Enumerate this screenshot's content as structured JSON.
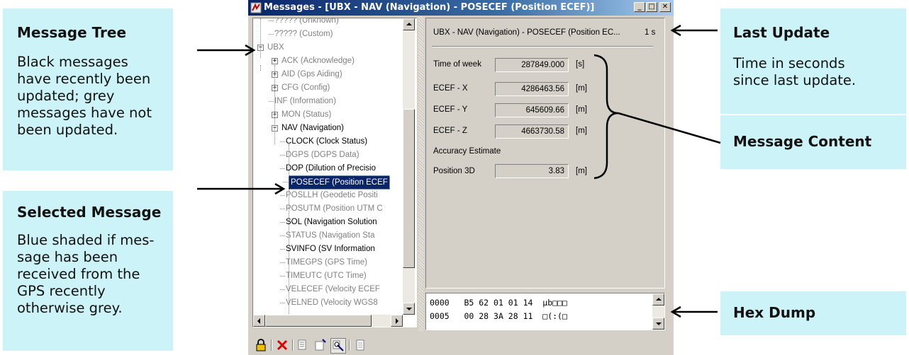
{
  "window": {
    "title": "Messages - [UBX - NAV (Navigation) - POSECEF (Position ECEF)]",
    "buttons": {
      "minimize": "_",
      "maximize": "□",
      "close": "✕"
    }
  },
  "tree": {
    "nodes": [
      {
        "label": "????? (Unknown)",
        "state": "grey"
      },
      {
        "label": "????? (Custom)",
        "state": "grey"
      },
      {
        "label": "UBX",
        "state": "grey",
        "expander": "−"
      },
      {
        "label": "ACK (Acknowledge)",
        "state": "grey",
        "expander": "+"
      },
      {
        "label": "AID (Gps Aiding)",
        "state": "grey",
        "expander": "+"
      },
      {
        "label": "CFG (Config)",
        "state": "grey",
        "expander": "+"
      },
      {
        "label": "INF (Information)",
        "state": "grey"
      },
      {
        "label": "MON (Status)",
        "state": "grey",
        "expander": "+"
      },
      {
        "label": "NAV (Navigation)",
        "state": "black",
        "expander": "−"
      },
      {
        "label": "CLOCK (Clock Status)",
        "state": "black"
      },
      {
        "label": "DGPS (DGPS Data)",
        "state": "grey"
      },
      {
        "label": "DOP (Dilution of Precisio",
        "state": "black"
      },
      {
        "label": "POSECEF (Position ECEF",
        "state": "selected"
      },
      {
        "label": "POSLLH (Geodetic Positi",
        "state": "grey"
      },
      {
        "label": "POSUTM (Position UTM C",
        "state": "grey"
      },
      {
        "label": "SOL (Navigation Solution",
        "state": "black"
      },
      {
        "label": "STATUS (Navigation Sta",
        "state": "grey"
      },
      {
        "label": "SVINFO (SV Information",
        "state": "black"
      },
      {
        "label": "TIMEGPS (GPS Time)",
        "state": "grey"
      },
      {
        "label": "TIMEUTC (UTC Time)",
        "state": "grey"
      },
      {
        "label": "VELECEF (Velocity ECEF",
        "state": "grey"
      },
      {
        "label": "VELNED (Velocity WGS8",
        "state": "grey"
      }
    ]
  },
  "content": {
    "header": "UBX - NAV (Navigation) - POSECEF (Position EC...",
    "age": "1 s",
    "fields": [
      {
        "label": "Time of week",
        "value": "287849.000",
        "unit": "[s]"
      },
      {
        "label": "ECEF - X",
        "value": "4286463.56",
        "unit": "[m]"
      },
      {
        "label": "ECEF - Y",
        "value": "645609.66",
        "unit": "[m]"
      },
      {
        "label": "ECEF - Z",
        "value": "4663730.58",
        "unit": "[m]"
      }
    ],
    "section": "Accuracy Estimate",
    "accuracy": {
      "label": "Position 3D",
      "value": "3.83",
      "unit": "[m]"
    }
  },
  "hexdump": {
    "rows": [
      {
        "offset": "0000",
        "bytes": "B5 62 01 01 14",
        "ascii": "µb□□□"
      },
      {
        "offset": "0005",
        "bytes": "00 28 3A 28 11",
        "ascii": "□(:(□"
      }
    ]
  },
  "toolbar": [
    "lock-icon",
    "delete-icon",
    "copy-icon",
    "properties-icon",
    "filter-icon",
    "print-icon"
  ],
  "callouts": {
    "message_tree": {
      "title": "Message Tree",
      "text": "Black messages have recently been updated; grey messages have not been updated."
    },
    "selected_message": {
      "title": "Selected Message",
      "text": "Blue shaded if mes-sage has been received from the GPS recently otherwise grey."
    },
    "last_update": {
      "title": "Last Update",
      "text": "Time in seconds since last update."
    },
    "message_content": {
      "title": "Message Content"
    },
    "hex_dump": {
      "title": "Hex Dump"
    }
  },
  "colors": {
    "callout_bg": "#ccf4f8",
    "selection": "#0a246a",
    "titlebar": "#0a246a"
  }
}
